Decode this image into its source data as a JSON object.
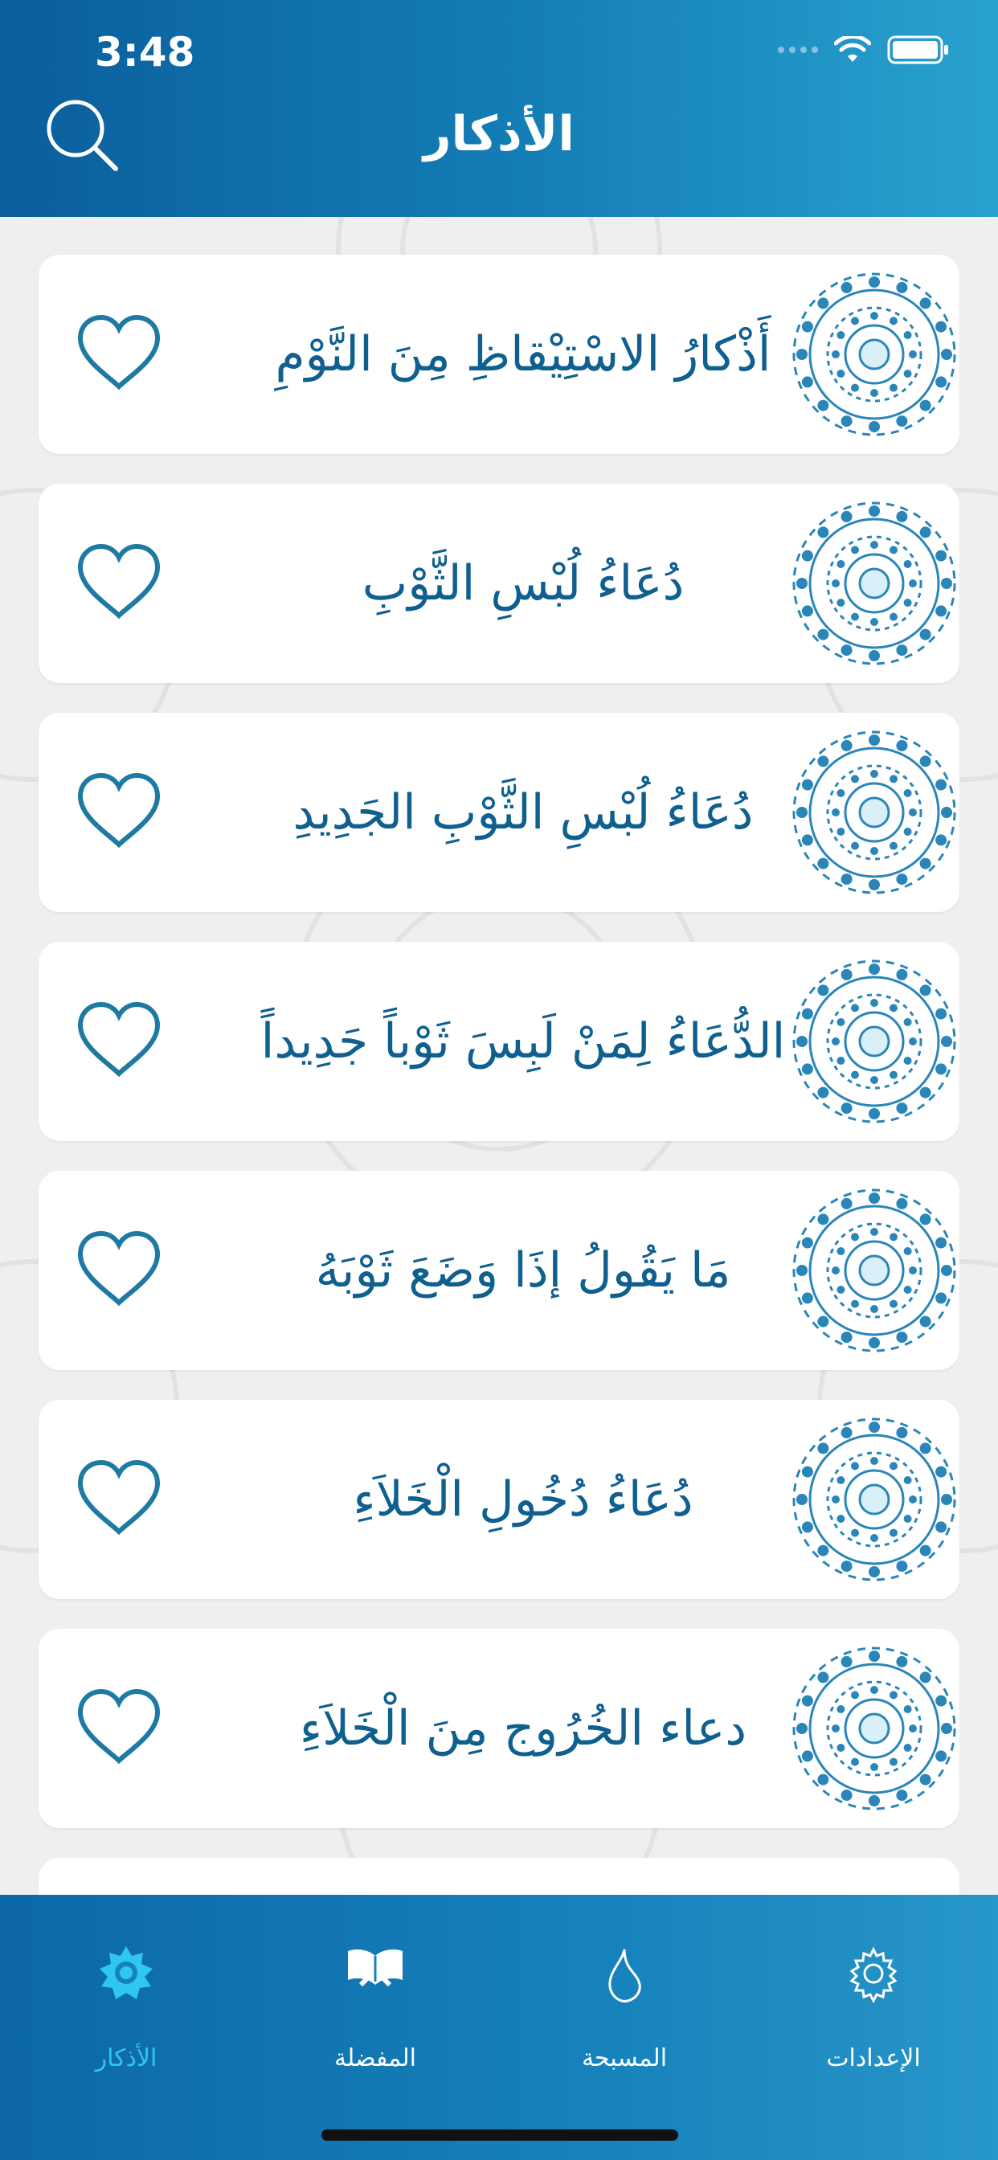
{
  "status_bar": {
    "time": "3:48"
  },
  "header": {
    "title": "الأذكار",
    "search_icon": "search-icon"
  },
  "list": {
    "items": [
      {
        "label": "أَذْكارُ الاسْتِيْقاظِ مِنَ النَّوْمِ"
      },
      {
        "label": "دُعَاءُ لُبْسِ الثَّوْبِ"
      },
      {
        "label": "دُعَاءُ لُبْسِ الثَّوْبِ الجَدِيدِ"
      },
      {
        "label": "الدُّعَاءُ لِمَنْ لَبِسَ ثَوْباً جَدِيداً"
      },
      {
        "label": "مَا يَقُولُ إذَا وَضَعَ ثَوْبَهُ"
      },
      {
        "label": "دُعَاءُ دُخُولِ الْخَلاَءِ"
      },
      {
        "label": "دعاء الخُرُوج مِنَ الْخَلاَءِ"
      }
    ]
  },
  "tabbar": {
    "tabs": [
      {
        "label": "الإعدادات",
        "icon": "gear-icon"
      },
      {
        "label": "المسبحة",
        "icon": "drop-icon"
      },
      {
        "label": "المفضلة",
        "icon": "quran-book-icon"
      },
      {
        "label": "الأذكار",
        "icon": "mandala-star-icon",
        "active": true
      }
    ]
  },
  "colors": {
    "header_start": "#0a5e9c",
    "header_end": "#29a2cf",
    "item_text": "#0f5f8f",
    "heart_stroke": "#1a6f9a",
    "active_tab": "#2fc6f0",
    "tabbar": "#1682bc"
  }
}
